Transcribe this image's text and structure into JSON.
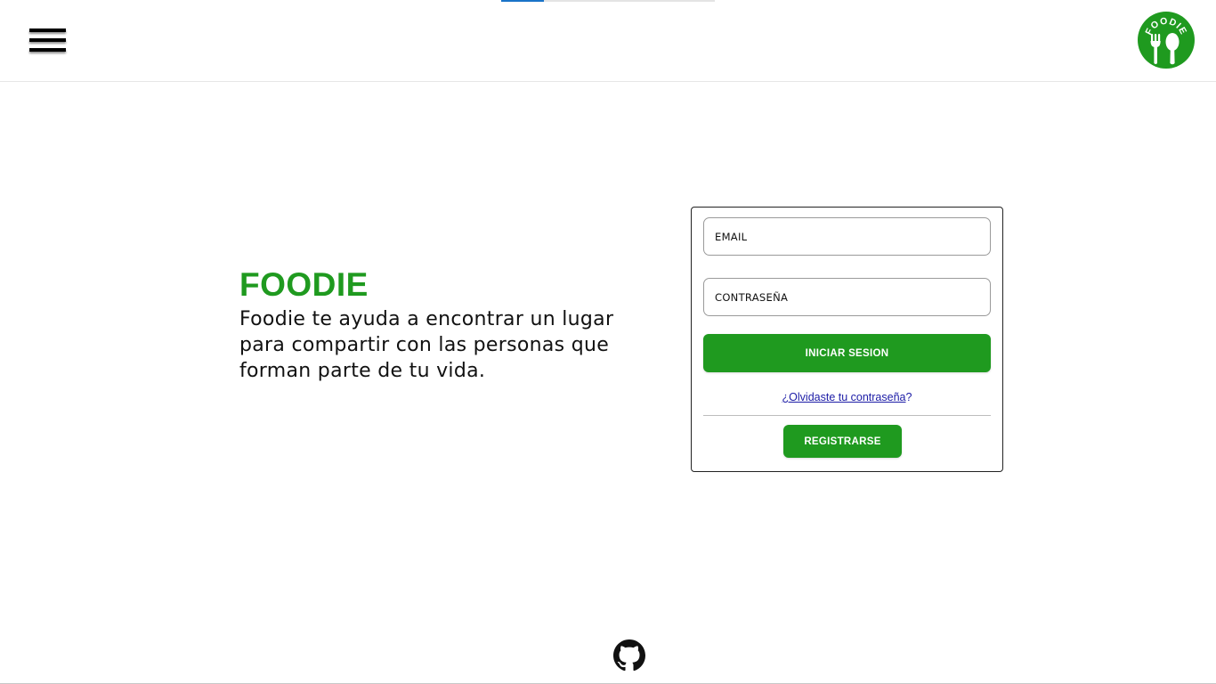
{
  "colors": {
    "brand_green": "#1f9a1f",
    "link_blue": "#1b1ba6",
    "progress_blue": "#1a73c8"
  },
  "top_progress": {
    "fill_percent": 20
  },
  "header": {
    "menu_icon": "hamburger-menu-icon",
    "logo": {
      "text": "FOODIE",
      "icon": "fork-and-spoon-logo"
    }
  },
  "hero": {
    "title": "FOODIE",
    "description": "Foodie te ayuda a encontrar un lugar para compartir con las personas que forman parte de tu vida."
  },
  "login": {
    "email_placeholder": "EMAIL",
    "password_placeholder": "CONTRASEÑA",
    "login_button": "INICIAR SESION",
    "forgot_link": "¿Olvidaste tu contraseña",
    "forgot_suffix": "?",
    "register_button": "REGISTRARSE"
  },
  "footer": {
    "github_icon": "github-icon"
  }
}
